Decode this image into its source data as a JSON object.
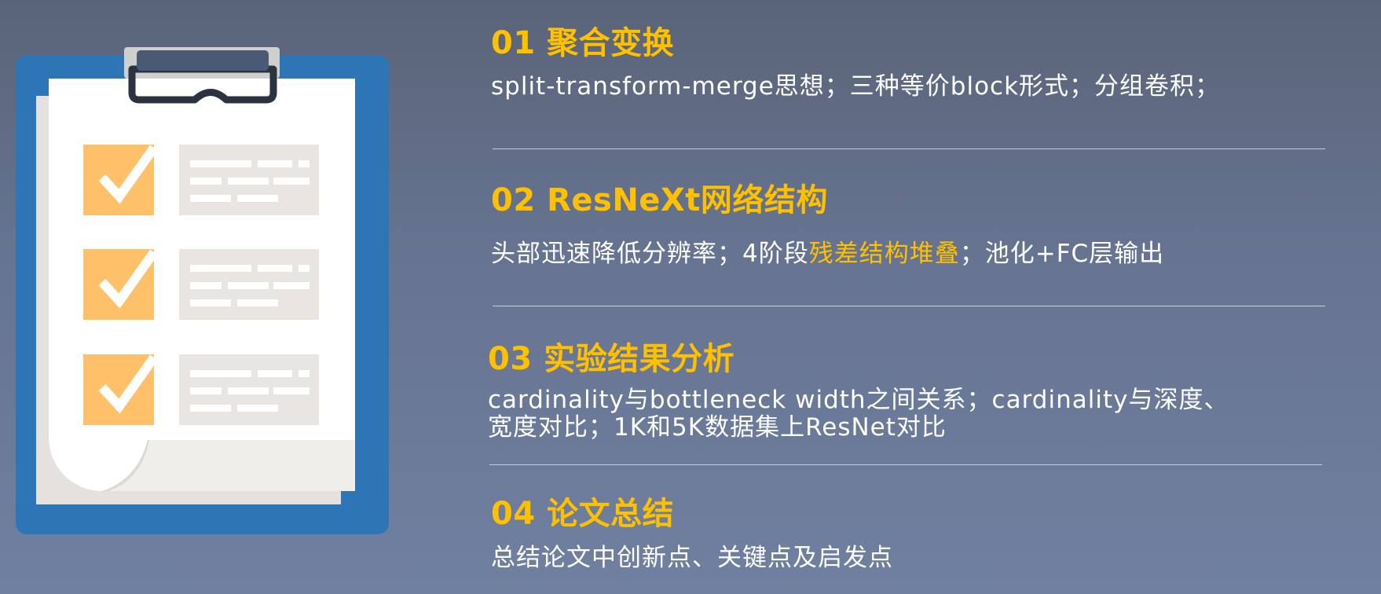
{
  "colors": {
    "accent": "#ffc000",
    "text": "#ffffff",
    "clipboard": "#2e75b6",
    "check": "#ffc06a"
  },
  "illustration": {
    "icon": "clipboard-checklist-icon",
    "checked_items": 3
  },
  "sections": [
    {
      "title": "01 聚合变换",
      "desc": "split-transform-merge思想；三种等价block形式；分组卷积；"
    },
    {
      "title": "02 ResNeXt网络结构",
      "desc_pre": "头部迅速降低分辨率；4阶段",
      "desc_highlight": "残差结构堆叠",
      "desc_post": "；池化+FC层输出"
    },
    {
      "title": "03 实验结果分析",
      "desc_line1": "cardinality与bottleneck width之间关系；cardinality与深度、",
      "desc_line2": "宽度对比；1K和5K数据集上ResNet对比"
    },
    {
      "title": "04 论文总结",
      "desc": "总结论文中创新点、关键点及启发点"
    }
  ]
}
